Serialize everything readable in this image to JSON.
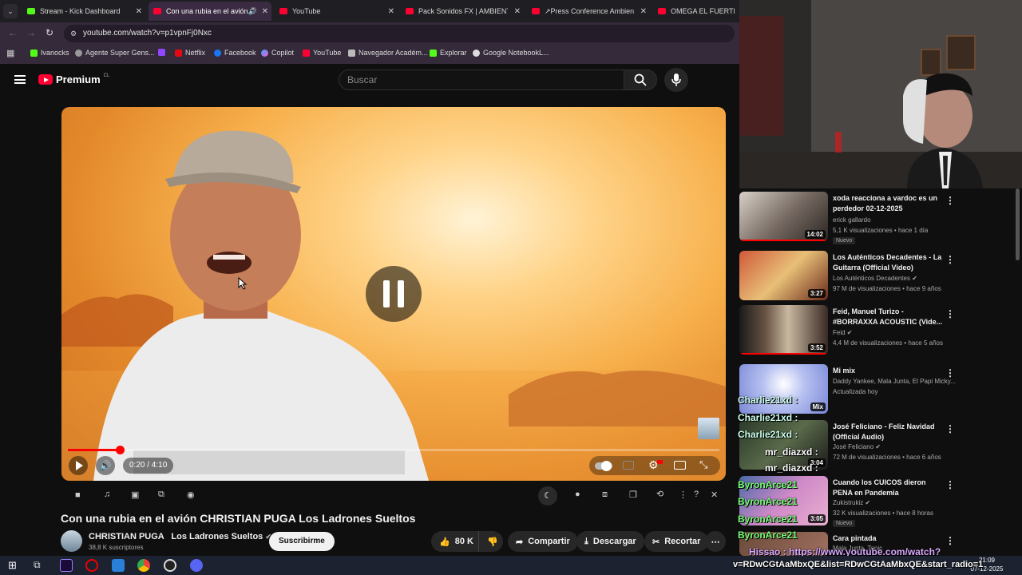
{
  "tabs": [
    {
      "title": "Stream - Kick Dashboard",
      "color": "#53fc18"
    },
    {
      "title": "Con una rubia en el avión C",
      "color": "#ff0033"
    },
    {
      "title": "YouTube",
      "color": "#ff0033"
    },
    {
      "title": "Pack Sonidos FX | AMBIENTE HI",
      "color": "#ff0033"
    },
    {
      "title": "↗Press Conference Ambience",
      "color": "#ff0033"
    },
    {
      "title": "OMEGA EL FUERTE ft. D",
      "color": "#ff0033"
    }
  ],
  "address": {
    "url": "youtube.com/watch?v=p1vpnFj0Nxc"
  },
  "bookmarks": [
    "Ivanocks",
    "Agente Super Gens...",
    "Netflix",
    "Facebook",
    "Copilot",
    "YouTube",
    "Navegador Académ...",
    "Explorar",
    "Google NotebookL..."
  ],
  "header": {
    "logo": "Premium",
    "region": "CL",
    "search_placeholder": "Buscar"
  },
  "player": {
    "time": "0:20 / 4:10",
    "progress": 0.08
  },
  "video": {
    "title": "Con una rubia en el avión CHRISTIAN PUGA Los Ladrones Sueltos",
    "channel": "CHRISTIAN PUGA",
    "channel_suffix": "Los Ladrones Sueltos",
    "subscribers": "38,8 K suscriptores",
    "subscribe": "Suscribirme",
    "likes": "80 K",
    "share": "Compartir",
    "download": "Descargar",
    "clip": "Recortar"
  },
  "recommendations": [
    {
      "title": "xoda reacciona a vardoc es un perdedor 02-12-2025",
      "channel": "erick gallardo",
      "meta": "5,1 K visualizaciones • hace 1 día",
      "badge": "Nuevo",
      "duration": "14:02",
      "thumb": "#8a7c72"
    },
    {
      "title": "Los Auténticos Decadentes - La Guitarra (Official Video)",
      "channel": "Los Auténticos Decadentes",
      "meta": "97 M de visualizaciones • hace 9 años",
      "badge": "",
      "duration": "3:27",
      "thumb": "#b24c2c"
    },
    {
      "title": "Feid, Manuel Turizo - #BORRAXXA ACOUSTIC (Vide...",
      "channel": "Feid",
      "meta": "4,4 M de visualizaciones • hace 5 años",
      "badge": "",
      "duration": "3:52",
      "thumb": "#4a3d34"
    },
    {
      "title": "Mi mix",
      "channel": "Daddy Yankee, Mala Junta, El Papi Micky...",
      "meta": "Actualizada hoy",
      "badge": "",
      "duration": "Mix",
      "thumb": "#9aa6e0"
    },
    {
      "title": "José Feliciano - Feliz Navidad (Official Audio)",
      "channel": "José Feliciano",
      "meta": "72 M de visualizaciones • hace 6 años",
      "badge": "",
      "duration": "3:04",
      "thumb": "#3a4a3a"
    },
    {
      "title": "Cuando los CUICOS dieron PENA en Pandemia",
      "channel": "Zukistrukiz",
      "meta": "32 K visualizaciones • hace 8 horas",
      "badge": "Nuevo",
      "duration": "3:05",
      "thumb": "#b06a9e"
    },
    {
      "title": "Cara pintada",
      "channel": "Mala Junta, Tonic",
      "meta": "",
      "badge": "",
      "duration": "",
      "thumb": "#6a4a3a"
    }
  ],
  "chat": [
    {
      "user": "Charlie21xd :",
      "color": "#cfe"
    },
    {
      "user": "Charlie21xd :",
      "color": "#cfe"
    },
    {
      "user": "Charlie21xd :",
      "color": "#cfe"
    },
    {
      "user": "mr_diazxd :",
      "color": "#7ff"
    },
    {
      "user": "mr_diazxd :",
      "color": "#7ff"
    },
    {
      "user": "ByronArce21",
      "color": "#7f7"
    },
    {
      "user": "ByronArce21",
      "color": "#7f7"
    },
    {
      "user": "ByronArce21",
      "color": "#7f7"
    },
    {
      "user": "ByronArce21",
      "color": "#7f7"
    },
    {
      "user": "Hissao : https://www.youtube.com/watch?",
      "color": "#d8a8ff"
    },
    {
      "user": "v=RDwCGtAaMbxQE&list=RDwCGtAaMbxQE&start_radio=1",
      "color": "#fff"
    }
  ],
  "taskbar": {
    "time": "21:09",
    "date": "07-12-2025"
  }
}
